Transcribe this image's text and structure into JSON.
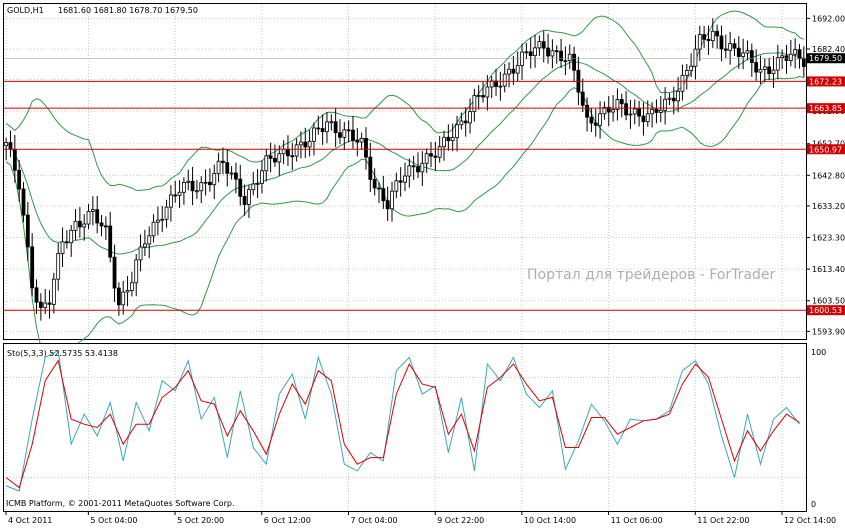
{
  "header": {
    "symbol": "GOLD,H1",
    "ohlc": "1681.60 1681.80 1678.70 1679.50"
  },
  "watermark": "Портал для трейдеров - ForTrader",
  "stochastic": {
    "label": "Sto(5,3,3) 52.5735 53.4138",
    "top_label": "100",
    "bottom_label": "0"
  },
  "footer": "ICMB Platform, © 2001-2011 MetaQuotes Software Corp.",
  "colors": {
    "background": "#ffffff",
    "grid": "#c8c8c8",
    "candles": "#000000",
    "bollinger": "#2e9a48",
    "levels": "#d00000",
    "stoch_main": "#3aa8b8",
    "stoch_signal": "#e00000",
    "current_price_tag": "#000000"
  },
  "chart_data": [
    {
      "type": "candlestick",
      "title": "GOLD,H1",
      "ylim": [
        1591.5,
        1696.5
      ],
      "y_ticks": [
        "1692.00",
        "1682.40",
        "1672.80",
        "1662.90",
        "1652.70",
        "1642.80",
        "1633.20",
        "1623.30",
        "1613.40",
        "1603.50",
        "1593.90"
      ],
      "x_ticks": [
        "4 Oct 2011",
        "5 Oct 04:00",
        "5 Oct 20:00",
        "6 Oct 12:00",
        "7 Oct 04:00",
        "9 Oct 22:00",
        "10 Oct 14:00",
        "11 Oct 06:00",
        "11 Oct 22:00",
        "12 Oct 14:00"
      ],
      "grid": "dotted",
      "current_price": "1679.50",
      "horizontal_levels": [
        "1672.23",
        "1663.85",
        "1650.97",
        "1600.53"
      ],
      "anchors": [
        [
          0,
          1652
        ],
        [
          3,
          1640
        ],
        [
          6,
          1610
        ],
        [
          8,
          1600
        ],
        [
          10,
          1603
        ],
        [
          13,
          1622
        ],
        [
          16,
          1628
        ],
        [
          20,
          1630
        ],
        [
          23,
          1625
        ],
        [
          26,
          1603
        ],
        [
          29,
          1610
        ],
        [
          32,
          1622
        ],
        [
          36,
          1632
        ],
        [
          40,
          1638
        ],
        [
          45,
          1640
        ],
        [
          50,
          1646
        ],
        [
          55,
          1636
        ],
        [
          60,
          1646
        ],
        [
          65,
          1651
        ],
        [
          70,
          1653
        ],
        [
          74,
          1660
        ],
        [
          78,
          1656
        ],
        [
          82,
          1652
        ],
        [
          85,
          1640
        ],
        [
          88,
          1634
        ],
        [
          92,
          1643
        ],
        [
          96,
          1648
        ],
        [
          100,
          1650
        ],
        [
          104,
          1658
        ],
        [
          108,
          1666
        ],
        [
          112,
          1670
        ],
        [
          116,
          1676
        ],
        [
          120,
          1680
        ],
        [
          124,
          1684
        ],
        [
          128,
          1680
        ],
        [
          130,
          1678
        ],
        [
          132,
          1670
        ],
        [
          134,
          1660
        ],
        [
          137,
          1662
        ],
        [
          141,
          1664
        ],
        [
          145,
          1663
        ],
        [
          149,
          1661
        ],
        [
          153,
          1666
        ],
        [
          157,
          1676
        ],
        [
          160,
          1684
        ],
        [
          163,
          1687
        ],
        [
          166,
          1684
        ],
        [
          170,
          1680
        ],
        [
          174,
          1676
        ],
        [
          178,
          1678
        ],
        [
          181,
          1680
        ],
        [
          184,
          1679.5
        ]
      ]
    },
    {
      "type": "line",
      "title": "Sto(5,3,3) 52.5735 53.4138",
      "ylim": [
        0,
        100
      ],
      "series": [
        {
          "name": "main",
          "points": [
            [
              0,
              15
            ],
            [
              3,
              12
            ],
            [
              6,
              55
            ],
            [
              9,
              92
            ],
            [
              12,
              96
            ],
            [
              15,
              40
            ],
            [
              18,
              58
            ],
            [
              21,
              45
            ],
            [
              24,
              65
            ],
            [
              27,
              30
            ],
            [
              30,
              65
            ],
            [
              33,
              48
            ],
            [
              36,
              78
            ],
            [
              39,
              72
            ],
            [
              42,
              90
            ],
            [
              45,
              55
            ],
            [
              48,
              68
            ],
            [
              51,
              32
            ],
            [
              54,
              72
            ],
            [
              57,
              38
            ],
            [
              60,
              28
            ],
            [
              63,
              70
            ],
            [
              66,
              82
            ],
            [
              69,
              55
            ],
            [
              72,
              92
            ],
            [
              75,
              70
            ],
            [
              78,
              28
            ],
            [
              81,
              24
            ],
            [
              84,
              35
            ],
            [
              87,
              30
            ],
            [
              90,
              84
            ],
            [
              93,
              92
            ],
            [
              96,
              70
            ],
            [
              99,
              75
            ],
            [
              102,
              35
            ],
            [
              105,
              68
            ],
            [
              108,
              24
            ],
            [
              111,
              88
            ],
            [
              114,
              78
            ],
            [
              117,
              92
            ],
            [
              120,
              70
            ],
            [
              123,
              62
            ],
            [
              126,
              72
            ],
            [
              129,
              25
            ],
            [
              132,
              42
            ],
            [
              135,
              64
            ],
            [
              138,
              54
            ],
            [
              141,
              40
            ],
            [
              144,
              55
            ],
            [
              147,
              54
            ],
            [
              150,
              55
            ],
            [
              153,
              60
            ],
            [
              156,
              84
            ],
            [
              159,
              90
            ],
            [
              162,
              76
            ],
            [
              165,
              45
            ],
            [
              168,
              20
            ],
            [
              171,
              58
            ],
            [
              174,
              28
            ],
            [
              177,
              55
            ],
            [
              180,
              62
            ],
            [
              183,
              52
            ]
          ]
        },
        {
          "name": "signal",
          "points": [
            [
              0,
              20
            ],
            [
              3,
              14
            ],
            [
              6,
              40
            ],
            [
              9,
              78
            ],
            [
              12,
              90
            ],
            [
              15,
              55
            ],
            [
              18,
              52
            ],
            [
              21,
              50
            ],
            [
              24,
              58
            ],
            [
              27,
              40
            ],
            [
              30,
              52
            ],
            [
              33,
              52
            ],
            [
              36,
              68
            ],
            [
              39,
              74
            ],
            [
              42,
              84
            ],
            [
              45,
              66
            ],
            [
              48,
              64
            ],
            [
              51,
              45
            ],
            [
              54,
              60
            ],
            [
              57,
              48
            ],
            [
              60,
              34
            ],
            [
              63,
              58
            ],
            [
              66,
              76
            ],
            [
              69,
              64
            ],
            [
              72,
              84
            ],
            [
              75,
              78
            ],
            [
              78,
              40
            ],
            [
              81,
              28
            ],
            [
              84,
              32
            ],
            [
              87,
              32
            ],
            [
              90,
              70
            ],
            [
              93,
              88
            ],
            [
              96,
              76
            ],
            [
              99,
              74
            ],
            [
              102,
              46
            ],
            [
              105,
              58
            ],
            [
              108,
              36
            ],
            [
              111,
              74
            ],
            [
              114,
              80
            ],
            [
              117,
              88
            ],
            [
              120,
              76
            ],
            [
              123,
              66
            ],
            [
              126,
              68
            ],
            [
              129,
              38
            ],
            [
              132,
              38
            ],
            [
              135,
              56
            ],
            [
              138,
              56
            ],
            [
              141,
              46
            ],
            [
              144,
              50
            ],
            [
              147,
              54
            ],
            [
              150,
              55
            ],
            [
              153,
              58
            ],
            [
              156,
              76
            ],
            [
              159,
              88
            ],
            [
              162,
              80
            ],
            [
              165,
              55
            ],
            [
              168,
              30
            ],
            [
              171,
              48
            ],
            [
              174,
              36
            ],
            [
              177,
              48
            ],
            [
              180,
              58
            ],
            [
              183,
              53
            ]
          ]
        }
      ]
    }
  ]
}
